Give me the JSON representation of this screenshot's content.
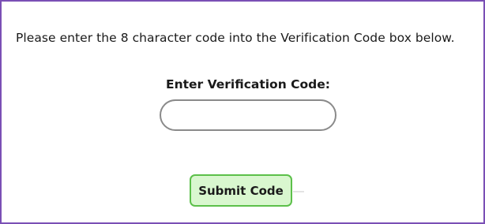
{
  "instructions": "Please enter the 8 character code into the Verification Code box below.",
  "verification": {
    "label": "Enter Verification Code:",
    "value": "",
    "placeholder": ""
  },
  "submit_label": "Submit Code",
  "colors": {
    "panel_border": "#7a4fb5",
    "input_border": "#8a8a8a",
    "button_border": "#5cc04a",
    "button_fill": "#d9f7cf"
  }
}
